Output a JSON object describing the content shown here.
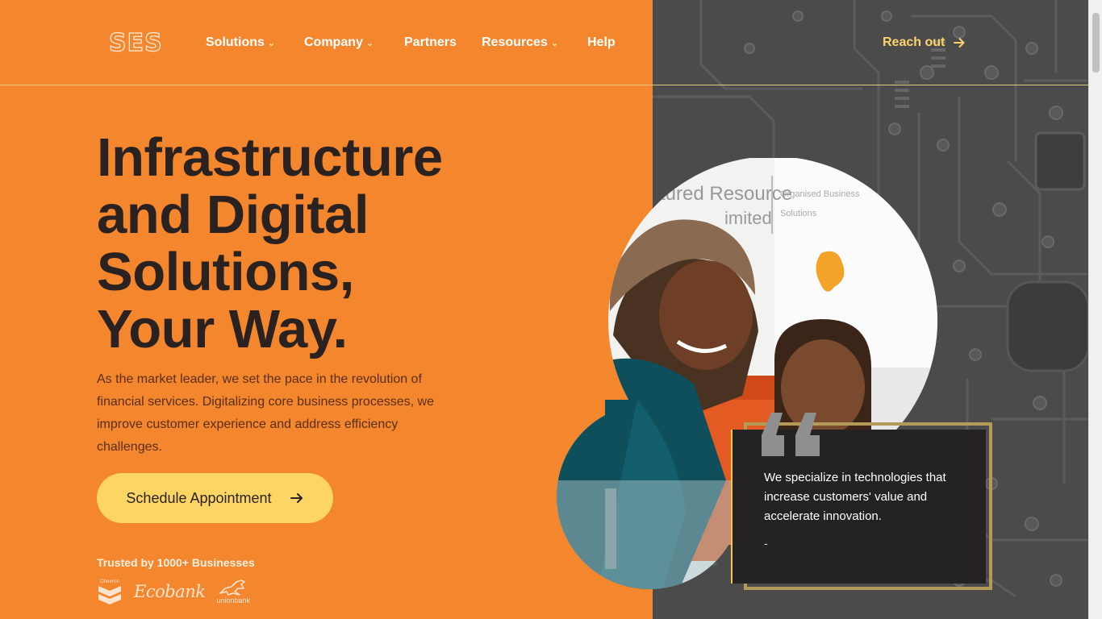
{
  "brand": {
    "logo_text": "SES"
  },
  "nav": {
    "items": [
      {
        "label": "Solutions",
        "has_dropdown": true
      },
      {
        "label": "Company",
        "has_dropdown": true
      },
      {
        "label": "Partners",
        "has_dropdown": false
      },
      {
        "label": "Resources",
        "has_dropdown": true
      },
      {
        "label": "Help",
        "has_dropdown": false
      }
    ],
    "reach_out": "Reach out"
  },
  "hero": {
    "title_lines": [
      "Infrastructure",
      "and Digital",
      "Solutions,",
      "Your Way."
    ],
    "description": "As the market leader, we set the pace in the revolution of financial services. Digitalizing core business processes, we improve customer experience and address efficiency challenges.",
    "cta_label": "Schedule Appointment",
    "trusted_label": "Trusted by 1000+ Businesses",
    "partner_logos": [
      {
        "name": "Chevron",
        "text": "Chevron"
      },
      {
        "name": "Ecobank",
        "text": "Ecobank"
      },
      {
        "name": "Union Bank",
        "text": "unionbank"
      }
    ]
  },
  "photo_signage": {
    "line1": "tured Resource",
    "line2": "imited",
    "side1": "Organised Business",
    "side2": "Solutions"
  },
  "quote": {
    "text": "We specialize in technologies that increase customers' value and accelerate innovation.",
    "attribution": "-"
  },
  "colors": {
    "orange": "#f4862e",
    "dark_panel": "#4a4a4a",
    "cta_yellow": "#fdd565",
    "accent_yellow": "#ffd36b",
    "quote_bg": "#252223",
    "gold_frame": "#b49a58"
  },
  "icons": {
    "chevron_down": "chevron-down-icon",
    "arrow_right": "arrow-right-icon",
    "quote": "quote-icon"
  }
}
